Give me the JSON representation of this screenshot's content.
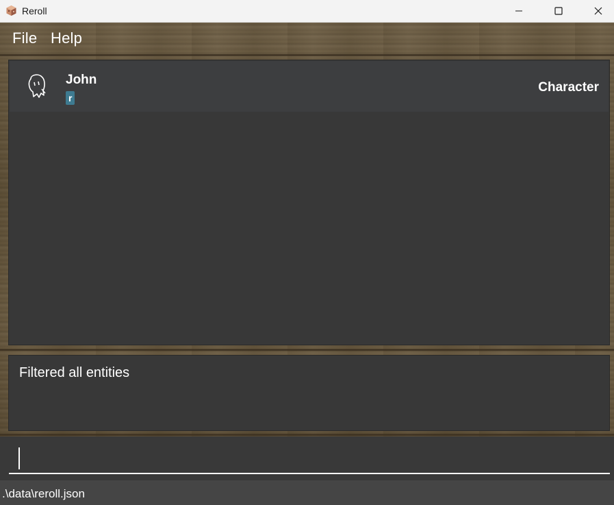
{
  "window": {
    "title": "Reroll",
    "app_icon": "cube-icon",
    "controls": [
      "minimize-icon",
      "maximize-icon",
      "close-icon"
    ]
  },
  "menu": {
    "items": [
      {
        "label": "File"
      },
      {
        "label": "Help"
      }
    ]
  },
  "entity_list": {
    "items": [
      {
        "name": "John",
        "tags": [
          "r"
        ],
        "type": "Character",
        "icon": "ghost-icon"
      }
    ]
  },
  "result": {
    "message": "Filtered all entities"
  },
  "command": {
    "value": "",
    "placeholder": ""
  },
  "status": {
    "file_path": ".\\data\\reroll.json"
  },
  "colors": {
    "panel_bg": "#383838",
    "card_bg": "#3d3e40",
    "tag_bg": "#3e7b91",
    "status_bg": "#454545",
    "titlebar_bg": "#f3f3f3"
  }
}
